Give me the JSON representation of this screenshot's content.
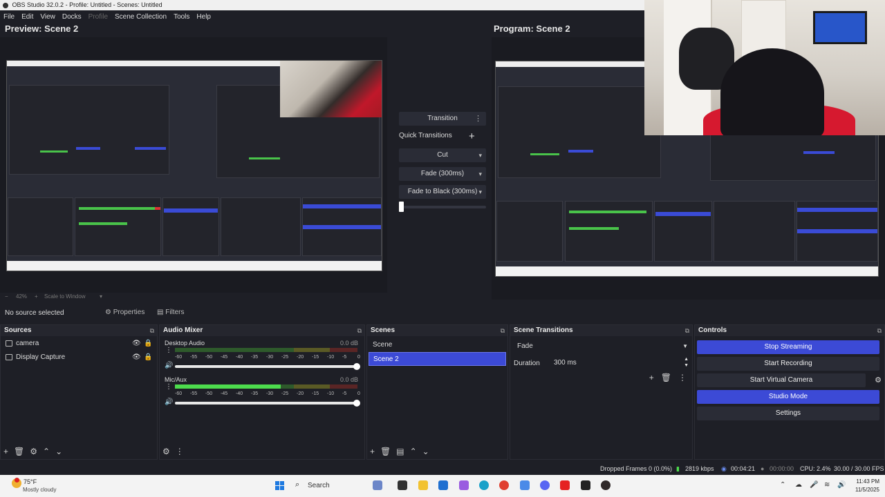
{
  "titlebar": {
    "title": "OBS Studio 32.0.2 - Profile: Untitled - Scenes: Untitled"
  },
  "menu": {
    "file": "File",
    "edit": "Edit",
    "view": "View",
    "docks": "Docks",
    "profile": "Profile",
    "scene_collection": "Scene Collection",
    "tools": "Tools",
    "help": "Help"
  },
  "preview": {
    "title": "Preview: Scene 2",
    "zoom": "42%",
    "scale_label": "Scale to Window"
  },
  "program": {
    "title": "Program: Scene 2"
  },
  "transitions_panel": {
    "transition_label": "Transition",
    "quick_transitions_label": "Quick Transitions",
    "quick_items": [
      "Cut",
      "Fade (300ms)",
      "Fade to Black (300ms)"
    ]
  },
  "context": {
    "no_source": "No source selected",
    "properties": "Properties",
    "filters": "Filters"
  },
  "sources": {
    "title": "Sources",
    "items": [
      {
        "name": "camera",
        "icon": "camera-icon"
      },
      {
        "name": "Display Capture",
        "icon": "monitor-icon"
      }
    ]
  },
  "audio_mixer": {
    "title": "Audio Mixer",
    "tick_labels": [
      "-60",
      "-55",
      "-50",
      "-45",
      "-40",
      "-35",
      "-30",
      "-25",
      "-20",
      "-15",
      "-10",
      "-5",
      "0"
    ],
    "tracks": [
      {
        "name": "Desktop Audio",
        "db": "0.0 dB",
        "level": 0.0,
        "volume": 1.0
      },
      {
        "name": "Mic/Aux",
        "db": "0.0 dB",
        "level": 0.58,
        "volume": 1.0
      }
    ]
  },
  "scenes": {
    "title": "Scenes",
    "items": [
      "Scene",
      "Scene 2"
    ],
    "active_index": 1
  },
  "scene_transitions": {
    "title": "Scene Transitions",
    "selected": "Fade",
    "duration_label": "Duration",
    "duration_value": "300 ms"
  },
  "controls": {
    "title": "Controls",
    "stop_streaming": "Stop Streaming",
    "start_recording": "Start Recording",
    "start_virtual_camera": "Start Virtual Camera",
    "studio_mode": "Studio Mode",
    "settings": "Settings"
  },
  "status": {
    "dropped_frames": "Dropped Frames 0 (0.0%)",
    "bitrate": "2819 kbps",
    "stream_time": "00:04:21",
    "rec_time": "00:00:00",
    "cpu": "CPU: 2.4%",
    "fps": "30.00 / 30.00 FPS"
  },
  "taskbar": {
    "weather_temp": "75°F",
    "weather_cond": "Mostly cloudy",
    "search_placeholder": "Search",
    "time": "11:43 PM",
    "date": "11/5/2025"
  },
  "colors": {
    "accent": "#3c4ad6",
    "background": "#1e1f26",
    "meter_green": "#4ddc4d"
  }
}
